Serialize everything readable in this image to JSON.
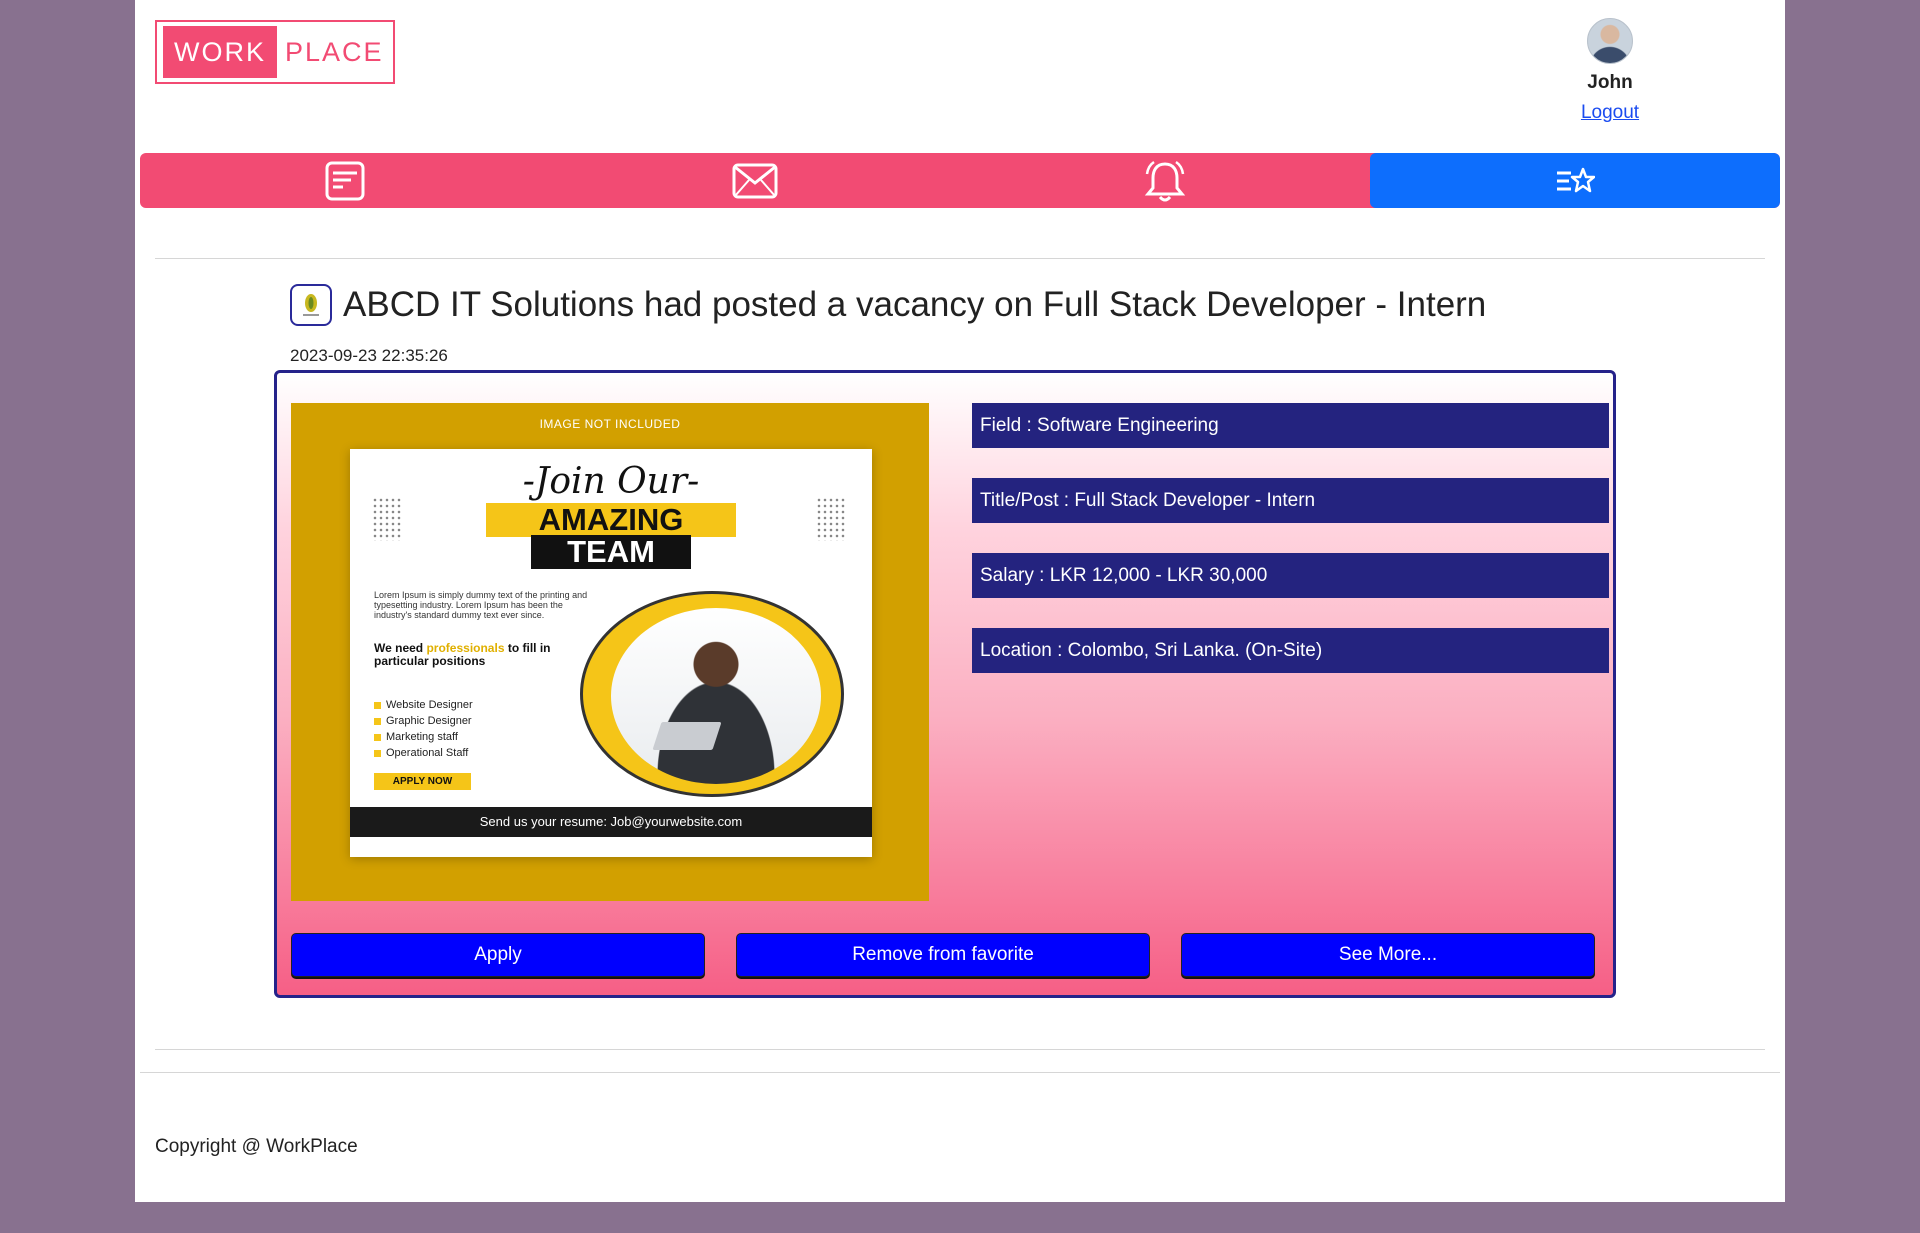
{
  "header": {
    "logo_part1": "WORK",
    "logo_part2": "PLACE",
    "user_name": "John",
    "logout_label": "Logout"
  },
  "navbar": {
    "items": [
      {
        "icon": "posts-icon",
        "active": false
      },
      {
        "icon": "mail-icon",
        "active": false
      },
      {
        "icon": "bell-icon",
        "active": false
      },
      {
        "icon": "favorites-list-icon",
        "active": true
      }
    ],
    "colors": {
      "bar": "#f24b73",
      "active": "#0d6efd"
    }
  },
  "post": {
    "heading": "ABCD IT Solutions had posted a vacancy on Full Stack Developer - Intern",
    "date": "2023-09-23 22:35:26",
    "poster": {
      "note": "IMAGE NOT INCLUDED",
      "join": "-Join Our-",
      "amazing": "AMAZING",
      "team": "TEAM",
      "lorem": "Lorem Ipsum is simply dummy text of the printing and typesetting industry. Lorem Ipsum has been the industry's standard dummy text ever since.",
      "need_prefix": "We need ",
      "need_highlight": "professionals",
      "need_suffix": " to fill in particular positions",
      "list": [
        "Website Designer",
        "Graphic Designer",
        "Marketing staff",
        "Operational Staff"
      ],
      "apply_now": "APPLY NOW",
      "resume": "Send us your resume: Job@yourwebsite.com"
    },
    "fields": {
      "field": "Field : Software Engineering",
      "title": "Title/Post : Full Stack Developer - Intern",
      "salary": "Salary : LKR 12,000 - LKR 30,000",
      "location": "Location : Colombo, Sri Lanka. (On-Site)"
    },
    "actions": {
      "apply": "Apply",
      "remove_favorite": "Remove from favorite",
      "see_more": "See More..."
    }
  },
  "footer": {
    "copyright": "Copyright @ WorkPlace"
  }
}
